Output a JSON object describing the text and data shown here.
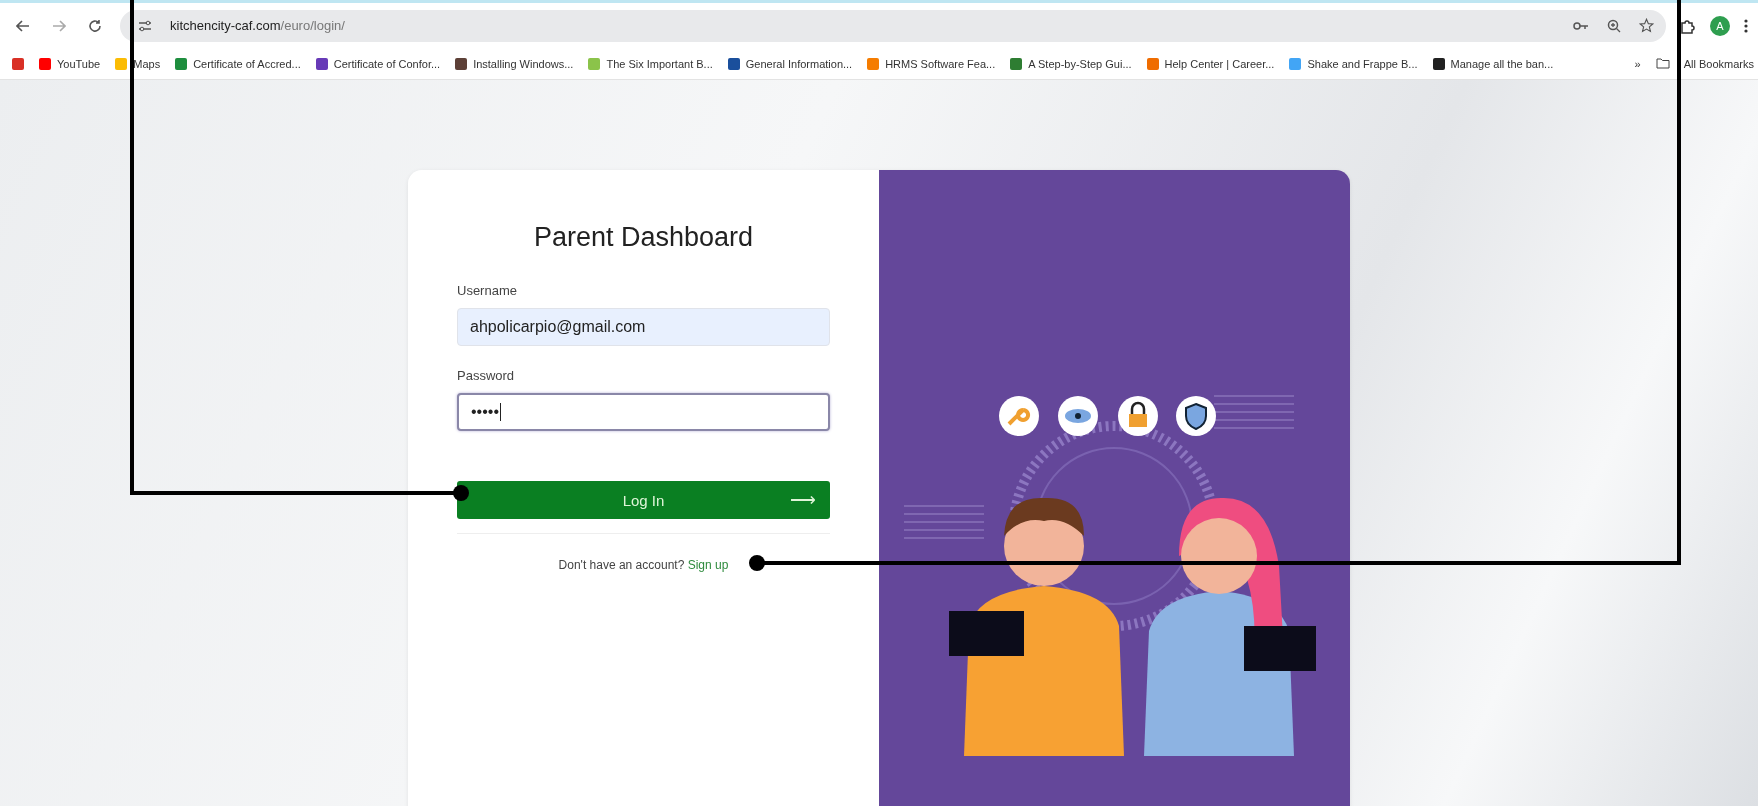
{
  "browser": {
    "url_host": "kitchencity-caf.com",
    "url_path": "/euro/login/",
    "profile_initial": "A",
    "bookmarks": [
      {
        "color": "#d93025"
      },
      {
        "label": "YouTube",
        "color": "#ff0000"
      },
      {
        "label": "Maps",
        "color": "#fbbc04"
      },
      {
        "label": "Certificate of Accred...",
        "color": "#1e8e3e"
      },
      {
        "label": "Certificate of Confor...",
        "color": "#673ab7"
      },
      {
        "label": "Installing Windows...",
        "color": "#5d4037"
      },
      {
        "label": "The Six Important B...",
        "color": "#8bc34a"
      },
      {
        "label": "General Information...",
        "color": "#1a4f9c"
      },
      {
        "label": "HRMS Software Fea...",
        "color": "#f57c00"
      },
      {
        "label": "A Step-by-Step Gui...",
        "color": "#2e7d32"
      },
      {
        "label": "Help Center | Career...",
        "color": "#ef6c00"
      },
      {
        "label": "Shake and Frappe B...",
        "color": "#42a5f5"
      },
      {
        "label": "Manage all the ban...",
        "color": "#212121"
      }
    ],
    "overflow": "»",
    "all_bookmarks": "All Bookmarks"
  },
  "login": {
    "title": "Parent Dashboard",
    "fields": [
      {
        "label": "Username",
        "value": "ahpolicarpio@gmail.com",
        "autofilled": true,
        "focused": false
      },
      {
        "label": "Password",
        "value": "•••••",
        "autofilled": false,
        "focused": true
      }
    ],
    "button": {
      "label": "Log In",
      "arrow": "⟶"
    },
    "signup_prompt": "Don't have an account?",
    "signup_link": "Sign up"
  }
}
